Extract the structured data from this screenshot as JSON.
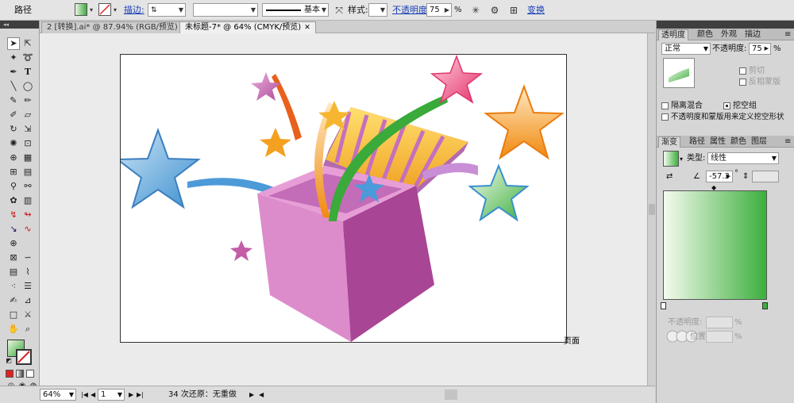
{
  "control_bar": {
    "object_type": "路径",
    "stroke_label": "描边:",
    "stroke_weight": "",
    "brush_label": "基本",
    "style_label": "样式:",
    "opacity_label": "不透明度:",
    "opacity_value": "75",
    "opacity_unit": "%",
    "transform_label": "变换"
  },
  "tabs": [
    {
      "label": "2 [转换].ai* @ 87.94% (RGB/预览)",
      "close": "✕"
    },
    {
      "label": "未标题-7* @ 64% (CMYK/预览)",
      "close": "✕"
    }
  ],
  "canvas": {
    "page_label": "页面"
  },
  "status_bar": {
    "zoom": "64%",
    "page_number": "1",
    "status_text": "34 次还原：无重做"
  },
  "transparency_panel": {
    "tabs": [
      "透明度",
      "颜色",
      "外观",
      "描边"
    ],
    "blend_mode": "正常",
    "opacity_label": "不透明度:",
    "opacity_value": "75",
    "opacity_unit": "%",
    "clip_label": "剪切",
    "invert_mask_label": "反相蒙版",
    "isolate_blending_label": "隔离混合",
    "knockout_group_label": "挖空组",
    "opacity_mask_label": "不透明度和蒙版用来定义挖空形状"
  },
  "gradient_panel": {
    "tabs": [
      "渐变",
      "路径",
      "属性",
      "颜色",
      "图层"
    ],
    "type_label": "类型:",
    "type_value": "线性",
    "angle_value": "-57.3",
    "angle_unit": "°",
    "stop_opacity_label": "不透明度:",
    "stop_opacity_unit": "%",
    "location_label": "位置:",
    "location_unit": "%",
    "gradient_start_color": "#f4fbee",
    "gradient_end_color": "#3daf3d"
  },
  "colors": {
    "accent_link": "#1a3fb8",
    "toolbar_bg": "#e4e4e4",
    "panel_header": "#3f3f3f"
  }
}
